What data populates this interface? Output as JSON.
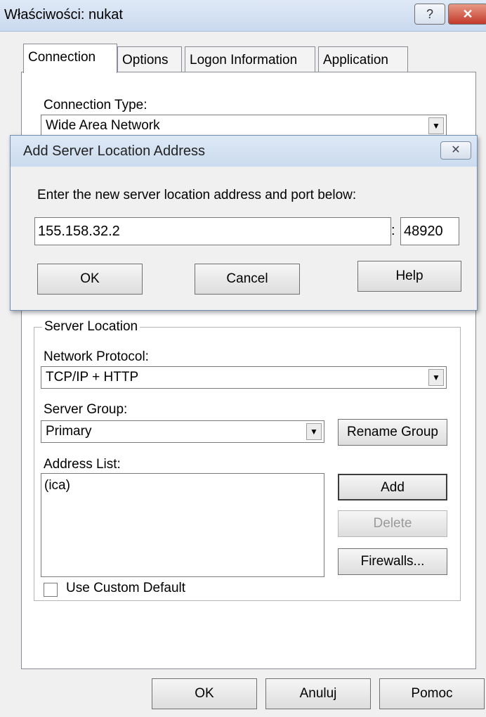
{
  "window": {
    "title": "Właściwości: nukat",
    "help_glyph": "?",
    "close_glyph": "✕"
  },
  "tabs": [
    {
      "label": "Connection"
    },
    {
      "label": "Options"
    },
    {
      "label": "Logon Information"
    },
    {
      "label": "Application"
    }
  ],
  "connection": {
    "type_label": "Connection Type:",
    "type_value": "Wide Area Network"
  },
  "dialog": {
    "title": "Add Server Location Address",
    "close_glyph": "✕",
    "prompt": "Enter the new server location address and port below:",
    "address_value": "155.158.32.2",
    "separator": ":",
    "port_value": "48920",
    "ok_label": "OK",
    "cancel_label": "Cancel",
    "help_label": "Help"
  },
  "server_location": {
    "group_title": "Server Location",
    "protocol_label": "Network Protocol:",
    "protocol_value": "TCP/IP + HTTP",
    "group_label": "Server Group:",
    "group_value": "Primary",
    "rename_label": "Rename Group",
    "address_list_label": "Address List:",
    "addresses": [
      "(ica)"
    ],
    "add_label": "Add",
    "delete_label": "Delete",
    "firewalls_label": "Firewalls...",
    "custom_default_label": "Use Custom Default",
    "custom_default_checked": false
  },
  "footer": {
    "ok_label": "OK",
    "cancel_label": "Anuluj",
    "help_label": "Pomoc"
  },
  "colors": {
    "titlebar": "#c9d9ee",
    "close_button": "#c4382a",
    "panel": "#ffffff",
    "window_bg": "#f0f0f0"
  },
  "icons": {
    "dropdown": "chevron-down-icon",
    "close": "close-icon",
    "help": "help-icon"
  }
}
